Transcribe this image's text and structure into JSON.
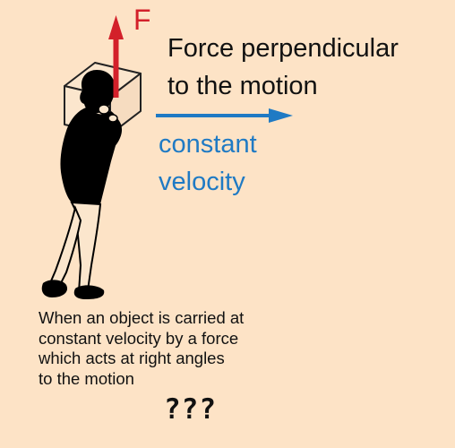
{
  "diagram": {
    "force_symbol": "F",
    "force_title_lines": [
      "Force perpendicular",
      "to the motion"
    ],
    "velocity_lines": [
      "constant",
      "velocity"
    ],
    "caption_lines": [
      "When an object is carried at",
      "constant velocity by a force",
      "which acts at right angles",
      "to the motion"
    ],
    "question_marks": "???"
  },
  "colors": {
    "background": "#fde3c6",
    "force_arrow": "#d3202a",
    "velocity_arrow": "#1f7ac4",
    "text": "#111111",
    "figure": "#000000",
    "box_outline": "#222222"
  }
}
